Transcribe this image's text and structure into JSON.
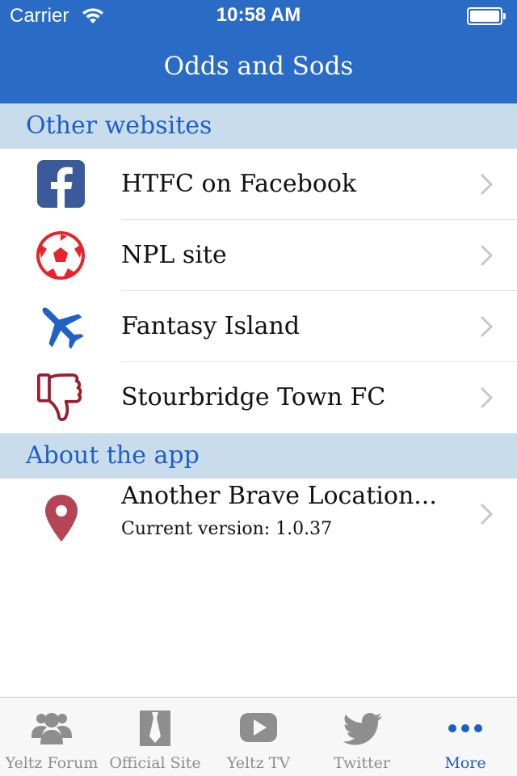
{
  "status_bar": {
    "carrier": "Carrier",
    "time": "10:58 AM"
  },
  "nav": {
    "title": "Odds and Sods"
  },
  "sections": {
    "other_websites": {
      "header": "Other websites",
      "items": [
        {
          "label": "HTFC on Facebook",
          "icon": "facebook-icon"
        },
        {
          "label": "NPL site",
          "icon": "football-icon"
        },
        {
          "label": "Fantasy Island",
          "icon": "airplane-icon"
        },
        {
          "label": "Stourbridge Town FC",
          "icon": "thumbs-down-icon"
        }
      ]
    },
    "about": {
      "header": "About the app",
      "item": {
        "title": "Another Brave Location...",
        "subtitle": "Current version: 1.0.37",
        "icon": "location-pin-icon"
      }
    }
  },
  "tab_bar": {
    "tabs": [
      {
        "label": "Yeltz Forum",
        "icon": "group-icon",
        "active": false
      },
      {
        "label": "Official Site",
        "icon": "tie-icon",
        "active": false
      },
      {
        "label": "Yeltz TV",
        "icon": "play-icon",
        "active": false
      },
      {
        "label": "Twitter",
        "icon": "twitter-bird-icon",
        "active": false
      },
      {
        "label": "More",
        "icon": "more-dots-icon",
        "active": true
      }
    ]
  },
  "colors": {
    "nav_background": "#2a6bc5",
    "section_background": "#c9dcec",
    "accent_blue": "#1d5fc2",
    "facebook_blue": "#3b5a9a",
    "ball_red": "#e8232b",
    "plane_blue": "#1f62c4",
    "thumb_red": "#9b1c2e",
    "pin_red": "#b54455",
    "tab_inactive": "#8e8e8e"
  }
}
